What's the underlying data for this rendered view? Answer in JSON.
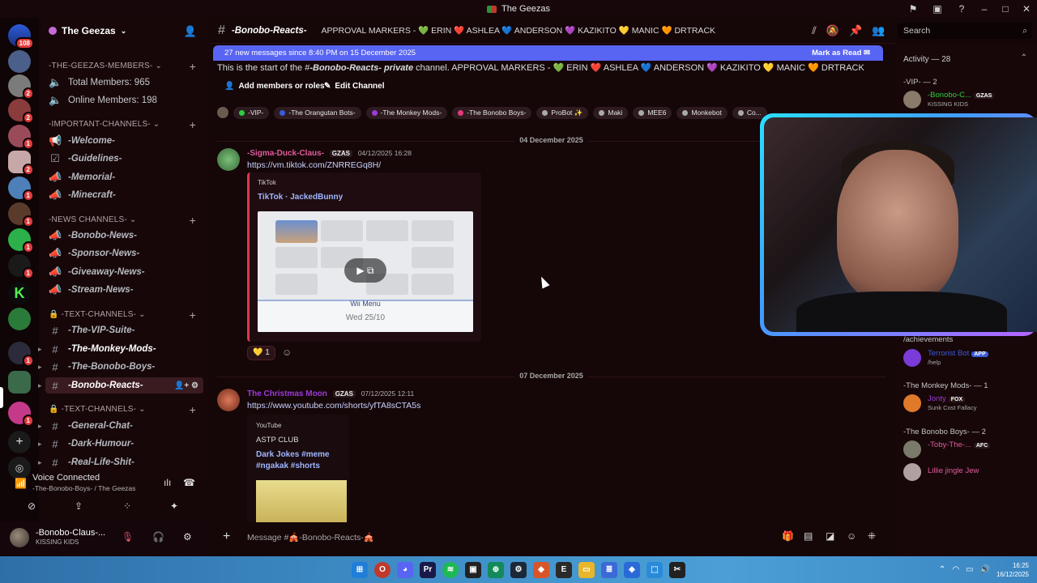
{
  "window": {
    "title": "The Geezas"
  },
  "server": {
    "name": "The Geezas"
  },
  "server_badges": [
    "108",
    "2",
    "2",
    "1",
    "2",
    "1",
    "1",
    "1",
    "1",
    "1",
    "1"
  ],
  "categories": {
    "members": "-THE-GEEZAS-MEMBERS-",
    "important": "-IMPORTANT-CHANNELS-",
    "news": "-NEWS CHANNELS-",
    "text1": "-TEXT-CHANNELS-",
    "text2": "-TEXT-CHANNELS-"
  },
  "stats": {
    "total": "Total Members: 965",
    "online": "Online Members: 198"
  },
  "channels": {
    "welcome": "-Welcome-",
    "guidelines": "-Guidelines-",
    "memorial": "-Memorial-",
    "minecraft": "-Minecraft-",
    "bonobo_news": "-Bonobo-News-",
    "sponsor_news": "-Sponsor-News-",
    "giveaway_news": "-Giveaway-News-",
    "stream_news": "-Stream-News-",
    "vip_suite": "-The-VIP-Suite-",
    "monkey_mods": "-The-Monkey-Mods-",
    "bonobo_boys": "-The-Bonobo-Boys-",
    "bonobo_reacts": "-Bonobo-Reacts-",
    "general_chat": "-General-Chat-",
    "dark_humour": "-Dark-Humour-",
    "real_life": "-Real-Life-Shit-"
  },
  "voice": {
    "status": "Voice Connected",
    "location": "-The-Bonobo-Boys- / The Geezas"
  },
  "user": {
    "name": "-Bonobo-Claus-...",
    "status": "KISSING KIDS"
  },
  "header": {
    "channel": "-Bonobo-Reacts-",
    "topic": "APPROVAL MARKERS - 💚 ERIN ❤️ ASHLEA 💙 ANDERSON 💜 KAZIKITO 💛 MANIC 🧡 DRTRACK"
  },
  "search": {
    "placeholder": "Search"
  },
  "newbar": {
    "text": "27 new messages since 8:40 PM on 15 December 2025",
    "mark": "Mark as Read"
  },
  "chat": {
    "start_prefix": "This is the start of the #",
    "start_channel": "-Bonobo-Reacts-",
    "start_private": "private",
    "start_suffix": "channel. APPROVAL MARKERS - 💚 ERIN ❤️ ASHLEA 💙 ANDERSON 💜 KAZIKITO 💛 MANIC 🧡 DRTRACK",
    "add_members": "Add members or roles",
    "edit_channel": "Edit Channel",
    "roles": [
      "-VIP-",
      "-The Orangutan Bots-",
      "-The Monkey Mods-",
      "-The Bonobo Boys-",
      "ProBot ✨",
      "Maki",
      "MEE6",
      "Monkebot",
      "Co..."
    ],
    "date1": "04 December 2025",
    "date2": "07 December 2025"
  },
  "messages": [
    {
      "author": "-Sigma-Duck-Claus-",
      "tag": "GZAS",
      "time": "04/12/2025 16:28",
      "link": "https://vm.tiktok.com/ZNRREGq8H/",
      "provider": "TikTok",
      "title": "TikTok · JackedBunny",
      "media_menu": "Wii Menu",
      "media_date": "Wed 25/10",
      "reaction": "1"
    },
    {
      "author": "The Christmas Moon",
      "tag": "GZAS",
      "time": "07/12/2025 12:11",
      "link": "https://www.youtube.com/shorts/yfTA8sCTA5s",
      "provider": "YouTube",
      "channel": "ASTP CLUB",
      "title": "Dark Jokes #meme #ngakak #shorts"
    }
  ],
  "composer": {
    "placeholder": "Message #🎪-Bonobo-Reacts-🎪"
  },
  "members_panel": {
    "activity": "Activity — 28",
    "vip_cat": "-VIP- — 2",
    "vip_member": "-Bonobo-C...",
    "vip_tag": "GZAS",
    "vip_status": "KISSING KIDS",
    "bot_activity": "/achievements",
    "bot_name": "Terrorist Bot",
    "bot_tag": "APP",
    "bot_status": "/help",
    "mods_cat": "-The Monkey Mods- — 1",
    "mod_name": "Jonty",
    "mod_tag": "FOX",
    "mod_status": "Sunk Cost Fallacy",
    "boys_cat": "-The Bonobo Boys- — 2",
    "boy1": "-Toby-The-...",
    "boy1_tag": "AFC",
    "boy2": "Lillie jingle Jew"
  },
  "taskbar": {
    "time": "16:25",
    "date": "16/12/2025"
  }
}
